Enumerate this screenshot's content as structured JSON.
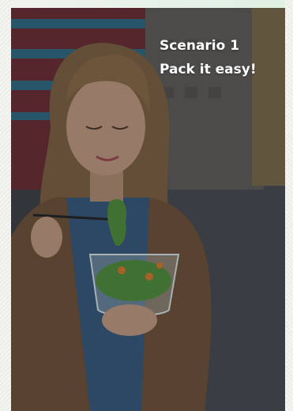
{
  "slide": {
    "scenario_label": "Scenario 1",
    "tagline": "Pack it easy!"
  },
  "photo": {
    "subject": "woman-eating-salad",
    "colors": {
      "building_red": "#7a3038",
      "building_blue": "#2f6f8a",
      "street": "#4b4e55",
      "coat": "#7a5a3e",
      "shirt": "#3a5f86",
      "hair": "#8a6a45",
      "skin": "#c9a38a",
      "salad": "#4f8f3a"
    }
  }
}
